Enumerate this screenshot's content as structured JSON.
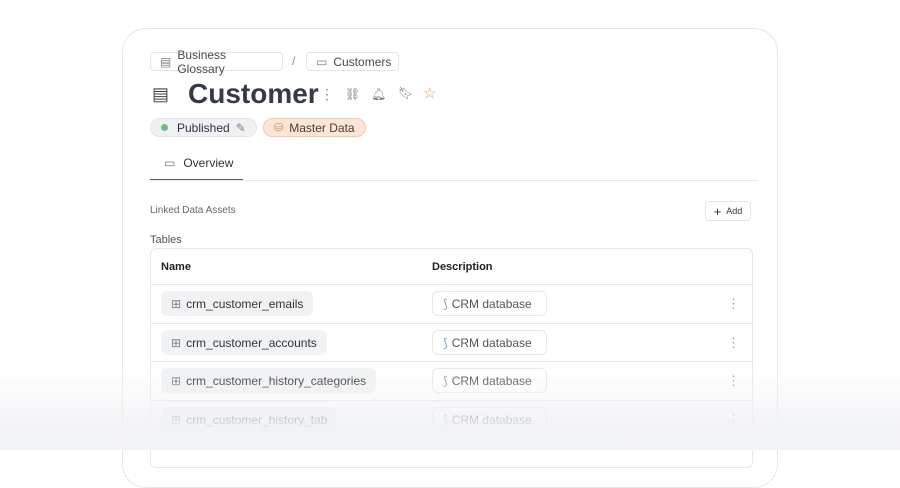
{
  "breadcrumb": [
    {
      "label": "Business Glossary",
      "icon": "book-icon"
    },
    {
      "label": "Customers",
      "icon": "glossary-term-icon"
    }
  ],
  "breadcrumb_separator": "/",
  "title": "Customer",
  "status": {
    "label": "Published",
    "color": "#6dbb85"
  },
  "tag": {
    "label": "Master Data",
    "bg": "#fde6d6",
    "border": "#f4c8a8"
  },
  "tabs": [
    {
      "label": "Overview",
      "active": true
    }
  ],
  "section_title": "Linked Data Assets",
  "add_label": "Add",
  "tables_label": "Tables",
  "columns": [
    "Name",
    "Description"
  ],
  "rows": [
    {
      "name": "crm_customer_emails",
      "description": "CRM database"
    },
    {
      "name": "crm_customer_accounts",
      "description": "CRM database"
    },
    {
      "name": "crm_customer_history_categories",
      "description": "CRM database"
    },
    {
      "name": "crm_customer_history_tab",
      "description": "CRM database"
    }
  ],
  "accent_star": "#f0a13a"
}
